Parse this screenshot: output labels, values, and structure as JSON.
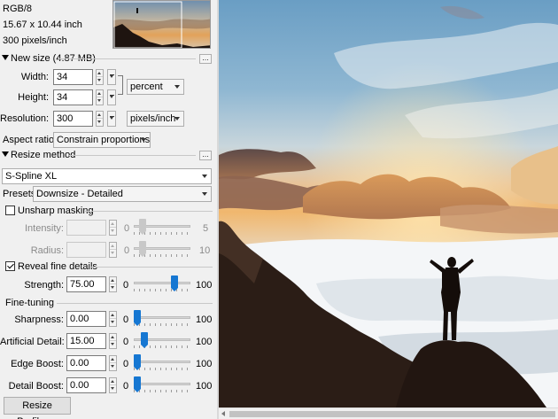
{
  "info": {
    "color_mode": "RGB/8",
    "dimensions": "15.67 x 10.44 inch",
    "resolution": "300 pixels/inch"
  },
  "new_size": {
    "header": "New size (4.87 MB)",
    "width_label": "Width:",
    "width_value": "34",
    "height_label": "Height:",
    "height_value": "34",
    "unit_value": "percent",
    "resolution_label": "Resolution:",
    "resolution_value": "300",
    "res_unit_value": "pixels/inch",
    "aspect_label": "Aspect ratio:",
    "aspect_value": "Constrain proportions"
  },
  "resize_method": {
    "header": "Resize method",
    "method_value": "S-Spline XL",
    "presets_label": "Presets:",
    "presets_value": "Downsize - Detailed"
  },
  "unsharp": {
    "label": "Unsharp masking",
    "checked": false,
    "intensity_label": "Intensity:",
    "intensity_min": "0",
    "intensity_max": "5",
    "intensity_level": 0.1,
    "radius_label": "Radius:",
    "radius_min": "0",
    "radius_max": "10",
    "radius_level": 0.1
  },
  "reveal": {
    "label": "Reveal fine details",
    "checked": true,
    "strength_label": "Strength:",
    "strength_value": "75.00",
    "strength_min": "0",
    "strength_max": "100",
    "strength_level": 0.75
  },
  "fine_tuning": {
    "header": "Fine-tuning",
    "rows": [
      {
        "label": "Sharpness:",
        "value": "0.00",
        "min": "0",
        "max": "100",
        "level": 0.0
      },
      {
        "label": "Artificial Detail:",
        "value": "15.00",
        "min": "0",
        "max": "100",
        "level": 0.15
      },
      {
        "label": "Edge Boost:",
        "value": "0.00",
        "min": "0",
        "max": "100",
        "level": 0.0
      },
      {
        "label": "Detail Boost:",
        "value": "0.00",
        "min": "0",
        "max": "100",
        "level": 0.0
      }
    ]
  },
  "buttons": {
    "resize_profiles": "Resize Profiles...",
    "more": "..."
  },
  "colors": {
    "accent": "#1677d2",
    "panel_bg": "#f0f0f0"
  }
}
